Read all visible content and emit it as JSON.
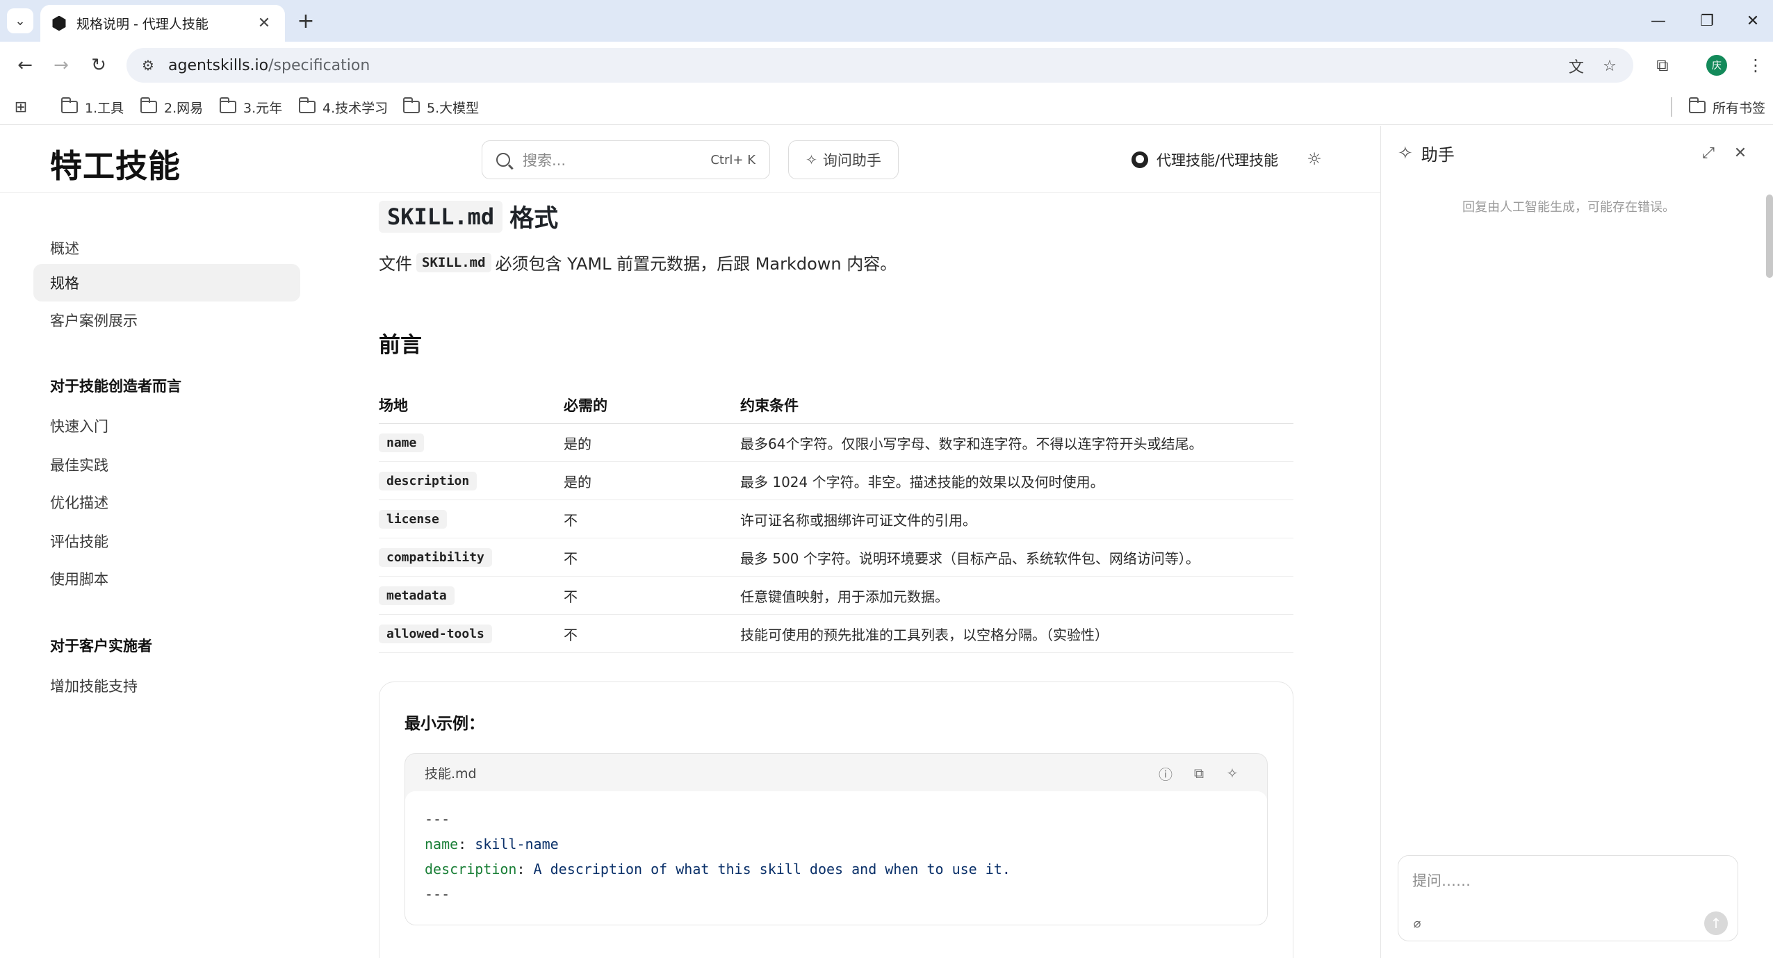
{
  "browser": {
    "tab_title": "规格说明 - 代理人技能",
    "url_host": "agentskills.io",
    "url_path": "/specification",
    "profile_initial": "庆",
    "bookmarks": [
      "1.工具",
      "2.网易",
      "3.元年",
      "4.技术学习",
      "5.大模型"
    ],
    "all_bookmarks": "所有书签"
  },
  "header": {
    "logo": "特工技能",
    "search_placeholder": "搜索...",
    "search_shortcut": "Ctrl+ K",
    "ask_label": "询问助手",
    "github_label": "代理技能/代理技能"
  },
  "sidebar": {
    "items": [
      "概述",
      "规格",
      "客户案例展示"
    ],
    "section1_title": "对于技能创造者而言",
    "section1_items": [
      "快速入门",
      "最佳实践",
      "优化描述",
      "评估技能",
      "使用脚本"
    ],
    "section2_title": "对于客户实施者",
    "section2_items": [
      "增加技能支持"
    ]
  },
  "main": {
    "format_code": "SKILL.md",
    "format_title": "格式",
    "intro_before": "文件",
    "intro_code": "SKILL.md",
    "intro_after": "必须包含 YAML 前置元数据，后跟 Markdown 内容。",
    "section_title": "前言",
    "table": {
      "headers": [
        "场地",
        "必需的",
        "约束条件"
      ],
      "rows": [
        {
          "field": "name",
          "required": "是的",
          "constraint": "最多64个字符。仅限小写字母、数字和连字符。不得以连字符开头或结尾。"
        },
        {
          "field": "description",
          "required": "是的",
          "constraint": "最多 1024 个字符。非空。描述技能的效果以及何时使用。"
        },
        {
          "field": "license",
          "required": "不",
          "constraint": "许可证名称或捆绑许可证文件的引用。"
        },
        {
          "field": "compatibility",
          "required": "不",
          "constraint": "最多 500 个字符。说明环境要求（目标产品、系统软件包、网络访问等）。"
        },
        {
          "field": "metadata",
          "required": "不",
          "constraint": "任意键值映射，用于添加元数据。"
        },
        {
          "field": "allowed-tools",
          "required": "不",
          "constraint": "技能可使用的预先批准的工具列表，以空格分隔。（实验性）"
        }
      ]
    },
    "example": {
      "title": "最小示例：",
      "filename": "技能.md",
      "line1": "---",
      "line2_key": "name",
      "line2_val": "skill-name",
      "line3_key": "description",
      "line3_val": "A description of what this skill does and when to use it.",
      "line4": "---"
    }
  },
  "assistant": {
    "title": "助手",
    "disclaimer": "回复由人工智能生成，可能存在错误。",
    "input_placeholder": "提问……"
  }
}
